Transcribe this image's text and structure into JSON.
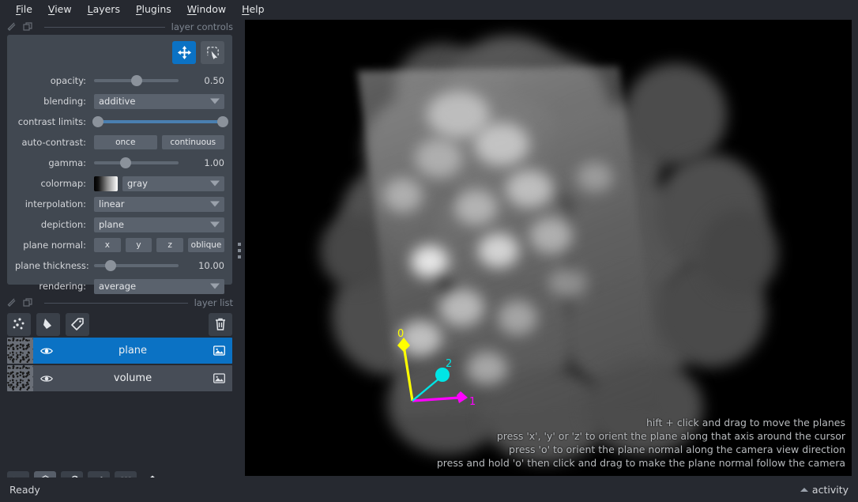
{
  "menubar": {
    "items": [
      {
        "pre": "",
        "accel": "F",
        "post": "ile"
      },
      {
        "pre": "",
        "accel": "V",
        "post": "iew"
      },
      {
        "pre": "",
        "accel": "L",
        "post": "ayers"
      },
      {
        "pre": "",
        "accel": "P",
        "post": "lugins"
      },
      {
        "pre": "",
        "accel": "W",
        "post": "indow"
      },
      {
        "pre": "",
        "accel": "H",
        "post": "elp"
      }
    ]
  },
  "layer_controls": {
    "title": "layer controls",
    "mode_buttons": [
      {
        "name": "pan-zoom",
        "active": true
      },
      {
        "name": "transform",
        "active": false
      }
    ],
    "opacity": {
      "label": "opacity:",
      "value": "0.50",
      "percent": 50
    },
    "blending": {
      "label": "blending:",
      "value": "additive"
    },
    "contrast_limits": {
      "label": "contrast limits:",
      "low_percent": 2,
      "high_percent": 98
    },
    "auto_contrast": {
      "label": "auto-contrast:",
      "once": "once",
      "continuous": "continuous"
    },
    "gamma": {
      "label": "gamma:",
      "value": "1.00",
      "percent": 37
    },
    "colormap": {
      "label": "colormap:",
      "value": "gray"
    },
    "interpolation": {
      "label": "interpolation:",
      "value": "linear"
    },
    "depiction": {
      "label": "depiction:",
      "value": "plane"
    },
    "plane_normal": {
      "label": "plane normal:",
      "x": "x",
      "y": "y",
      "z": "z",
      "oblique": "oblique"
    },
    "plane_thickness": {
      "label": "plane thickness:",
      "value": "10.00",
      "percent": 20
    },
    "rendering": {
      "label": "rendering:",
      "value": "average"
    }
  },
  "layer_list": {
    "title": "layer list",
    "buttons": [
      {
        "name": "new-points-layer"
      },
      {
        "name": "new-shapes-layer"
      },
      {
        "name": "new-labels-layer"
      },
      {
        "name": "delete-layer"
      }
    ],
    "layers": [
      {
        "name": "plane",
        "selected": true,
        "visible": true
      },
      {
        "name": "volume",
        "selected": false,
        "visible": true
      }
    ]
  },
  "viewer_buttons": [
    {
      "name": "console-button",
      "active": false
    },
    {
      "name": "ndisplay-toggle-button",
      "active": true
    },
    {
      "name": "roll-dims-button",
      "active": false
    },
    {
      "name": "transpose-dims-button",
      "active": false
    },
    {
      "name": "grid-view-button",
      "active": false
    },
    {
      "name": "reset-view-home-button",
      "active": false
    }
  ],
  "canvas": {
    "axes": [
      {
        "label": "0",
        "color": "#ffff00"
      },
      {
        "label": "1",
        "color": "#ff00ff"
      },
      {
        "label": "2",
        "color": "#00e5e5"
      }
    ],
    "hints": [
      "hift + click and drag to move the planes",
      "press 'x', 'y' or 'z' to orient the plane along that axis around the cursor",
      "press 'o' to orient the plane normal along the camera view direction",
      "press and hold 'o' then click and drag to make the plane normal follow the camera"
    ]
  },
  "statusbar": {
    "message": "Ready",
    "activity": "activity"
  },
  "colors": {
    "accent": "#0b72c4",
    "window_bg": "#262930",
    "panel_bg": "#414851",
    "canvas_bg": "#000000"
  }
}
